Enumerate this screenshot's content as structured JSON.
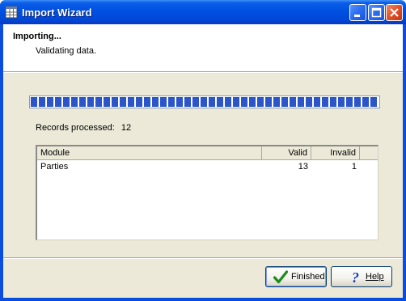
{
  "window": {
    "title": "Import Wizard"
  },
  "header": {
    "title": "Importing...",
    "subtitle": "Validating data."
  },
  "progress": {
    "fraction": 1.0
  },
  "records": {
    "label": "Records processed:",
    "value": "12"
  },
  "table": {
    "columns": [
      "Module",
      "Valid",
      "Invalid"
    ],
    "rows": [
      {
        "module": "Parties",
        "valid": "13",
        "invalid": "1"
      }
    ]
  },
  "buttons": {
    "finished": "Finished",
    "help": "Help"
  },
  "icons": {
    "title": "grid-icon",
    "finished": "check-icon",
    "help": "question-icon"
  }
}
